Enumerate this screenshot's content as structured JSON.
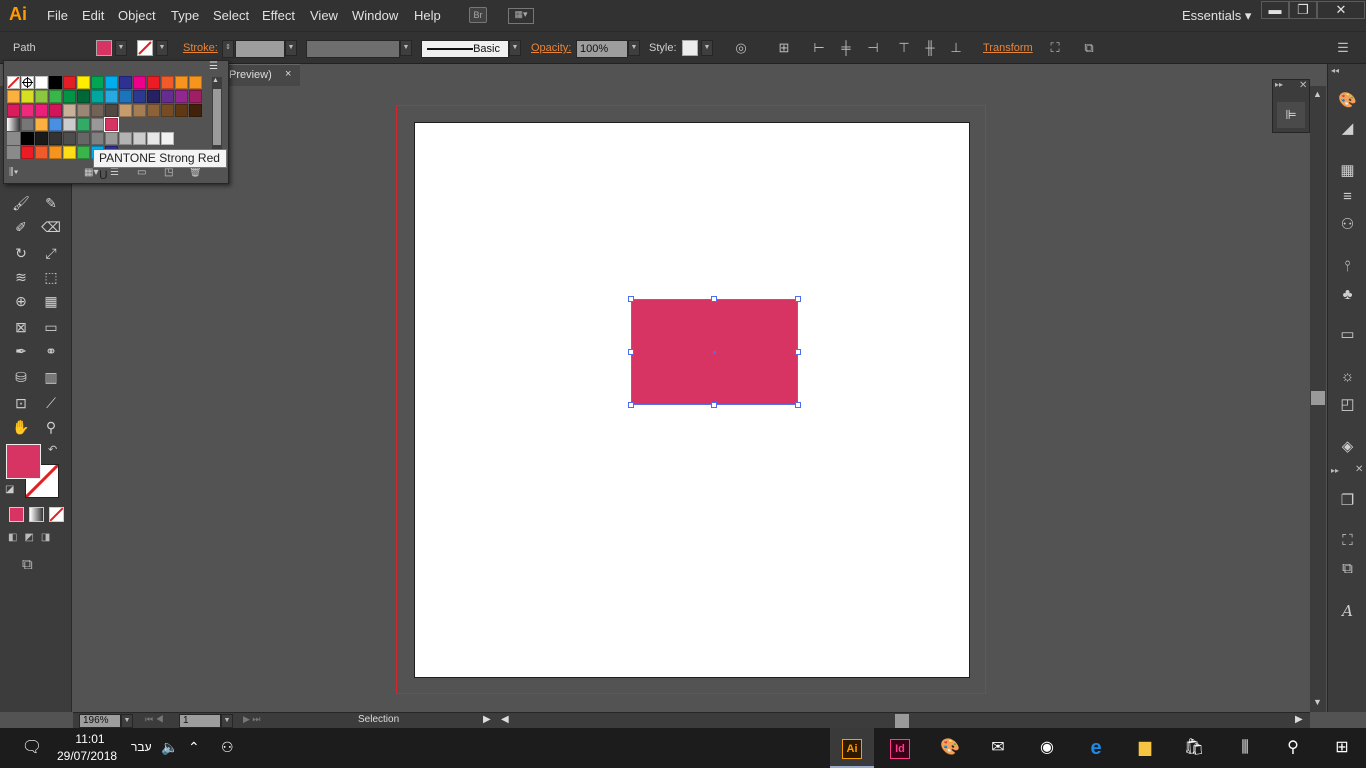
{
  "app": {
    "logo": "Ai"
  },
  "menu": [
    "File",
    "Edit",
    "Object",
    "Type",
    "Select",
    "Effect",
    "View",
    "Window",
    "Help"
  ],
  "br_button": "Br",
  "workspace": "Essentials",
  "control": {
    "selection_type": "Path",
    "stroke_label": "Stroke:",
    "brush_label": "Basic",
    "opacity_label": "Opacity:",
    "opacity_value": "100%",
    "style_label": "Style:",
    "transform_label": "Transform"
  },
  "doc_tab": {
    "title": "Preview)",
    "close": "×"
  },
  "swatch_tooltip": "PANTONE Strong Red U",
  "fill_color": "#d73463",
  "status": {
    "zoom": "196%",
    "artboard_num": "1",
    "tool": "Selection"
  },
  "taskbar": {
    "time": "11:01",
    "date": "29/07/2018",
    "lang": "עבר"
  },
  "colors": {
    "accent": "#ff9a00",
    "selection": "#4e6df0",
    "bleed": "#d2262c"
  }
}
